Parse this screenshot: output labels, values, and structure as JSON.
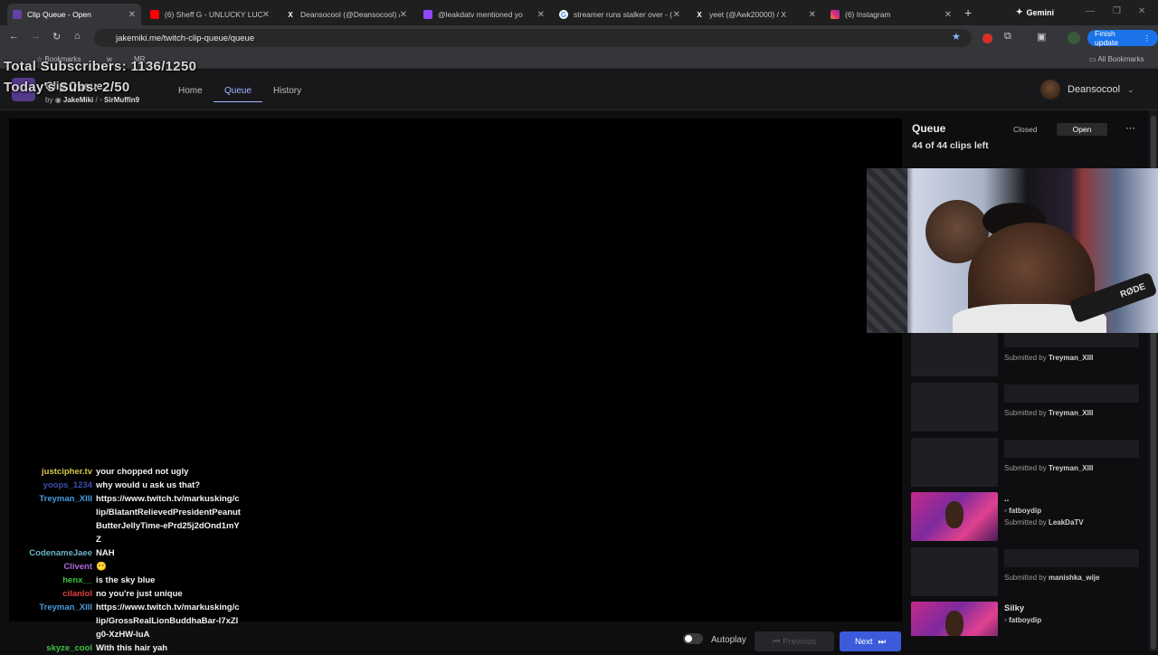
{
  "browser": {
    "tabs": [
      {
        "title": "Clip Queue - Open",
        "active": true,
        "icon": "twitch-icon"
      },
      {
        "title": "(6) Sheff G - UNLUCKY LUCK",
        "icon": "youtube-icon"
      },
      {
        "title": "Deansocool (@Deansocool) /",
        "icon": "x-icon"
      },
      {
        "title": "@leakdatv mentioned yo",
        "icon": "twitch-icon"
      },
      {
        "title": "streamer runs stalker over - (",
        "icon": "google-icon"
      },
      {
        "title": "yeet (@Awk20000) / X",
        "icon": "x-icon"
      },
      {
        "title": "(6) Instagram",
        "icon": "instagram-icon"
      }
    ],
    "gemini_label": "Gemini",
    "url": "jakemiki.me/twitch-clip-queue/queue",
    "finish_update_label": "Finish update",
    "bookmarks": {
      "label": "Bookmarks",
      "item2": "w",
      "item3": "MR",
      "all": "All Bookmarks"
    }
  },
  "overlay": {
    "total_subs": "Total Subscribers: 1136/1250",
    "today_subs": "Today's Subs: 2/50"
  },
  "app": {
    "title": "Clip Queue",
    "by": "by",
    "author1": "JakeMiki",
    "author2": "SirMuffin9",
    "nav": {
      "home": "Home",
      "queue": "Queue",
      "history": "History"
    },
    "username": "Deansocool"
  },
  "chat": [
    {
      "user": "justcipher.tv",
      "text": "your chopped not ugly",
      "color": "#d6c84a"
    },
    {
      "user": "yoops_1234",
      "text": "why would u ask us that?",
      "color": "#3b4fb0"
    },
    {
      "user": "Treyman_XIII",
      "text": "https://www.twitch.tv/markusking/clip/BlatantRelievedPresidentPeanutButterJellyTime-ePrd25j2dOnd1mYZ",
      "color": "#4a9bdc"
    },
    {
      "user": "CodenameJaee",
      "text": "NAH",
      "color": "#6db3c6"
    },
    {
      "user": "Clivent",
      "text": "😶",
      "color": "#b06ae0"
    },
    {
      "user": "henx__",
      "text": "is the sky blue",
      "color": "#3fc23f"
    },
    {
      "user": "cilanlol",
      "text": "no you're just unique",
      "color": "#e04040"
    },
    {
      "user": "Treyman_XIII",
      "text": "https://www.twitch.tv/markusking/clip/GrossRealLionBuddhaBar-I7xZlg0-XzHW-luA",
      "color": "#4a9bdc"
    },
    {
      "user": "skyze_cool",
      "text": "With this hair yah",
      "color": "#3fc23f"
    }
  ],
  "controls": {
    "autoplay": "Autoplay",
    "previous": "Previous",
    "next": "Next"
  },
  "queue": {
    "title": "Queue",
    "count": "44 of 44 clips left",
    "closed": "Closed",
    "open": "Open",
    "submitted_by": "Submitted by",
    "items": [
      {
        "submitter": "Treyman_XIII"
      },
      {
        "submitter": "Treyman_XIII"
      },
      {
        "submitter": "Treyman_XIII"
      },
      {
        "title": "..",
        "channel": "fatboydip",
        "submitter": "LeakDaTV"
      },
      {
        "submitter": "manishka_wije"
      },
      {
        "title": "Silky",
        "channel": "fatboydip"
      }
    ]
  },
  "webcam": {
    "mic_brand": "RØDE"
  }
}
